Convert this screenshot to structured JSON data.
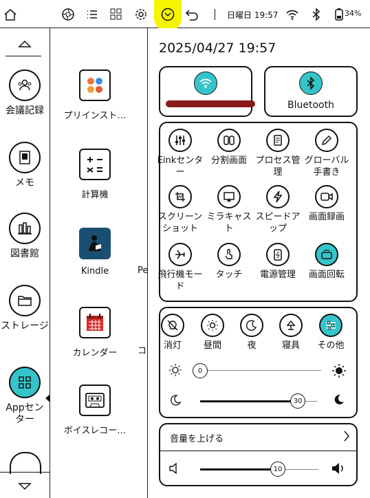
{
  "statusbar": {
    "datetime": "日曜日 19:57",
    "battery": "34%",
    "icons": [
      "home-icon",
      "aperture-icon",
      "list-icon",
      "apps-grid-icon",
      "gear-icon",
      "chevron-down-icon",
      "back-icon",
      "wifi-icon",
      "bluetooth-icon",
      "battery-icon"
    ]
  },
  "rail": {
    "items": [
      {
        "label": "会議記録",
        "icon": "meeting-icon"
      },
      {
        "label": "メモ",
        "icon": "notebook-icon"
      },
      {
        "label": "図書館",
        "icon": "library-icon"
      },
      {
        "label": "ストレージ",
        "icon": "folder-icon"
      },
      {
        "label": "Appセンター",
        "icon": "apps-icon"
      }
    ]
  },
  "apps": {
    "items": [
      {
        "label": "プリインスト…"
      },
      {
        "label": "計算機"
      },
      {
        "label": "Kindle"
      },
      {
        "label": "カレンダー"
      },
      {
        "label": "ボイスレコー…"
      }
    ],
    "edge_text_1": "Pe",
    "edge_text_2": "コ"
  },
  "panel": {
    "datetime": "2025/04/27 19:57",
    "wifi_label": "",
    "bluetooth_label": "Bluetooth",
    "controls": [
      {
        "label": "Einkセンター"
      },
      {
        "label": "分割画面"
      },
      {
        "label": "プロセス管理"
      },
      {
        "label": "グローバル手書き"
      },
      {
        "label": "スクリーンショット"
      },
      {
        "label": "ミラキャスト"
      },
      {
        "label": "スピードアップ"
      },
      {
        "label": "画面録画"
      },
      {
        "label": "飛行機モード"
      },
      {
        "label": "タッチ"
      },
      {
        "label": "電源管理"
      },
      {
        "label": "画面回転"
      }
    ],
    "light_modes": [
      {
        "label": "消灯"
      },
      {
        "label": "昼間"
      },
      {
        "label": "夜"
      },
      {
        "label": "寝具"
      },
      {
        "label": "その他"
      }
    ],
    "brightness_value": "0",
    "warmth_value": "30",
    "volume_header": "音量を上げる",
    "volume_value": "10",
    "colors": {
      "accent": "#35c4c9",
      "highlight": "#f5f500",
      "redaction": "#8a1a1a"
    }
  }
}
